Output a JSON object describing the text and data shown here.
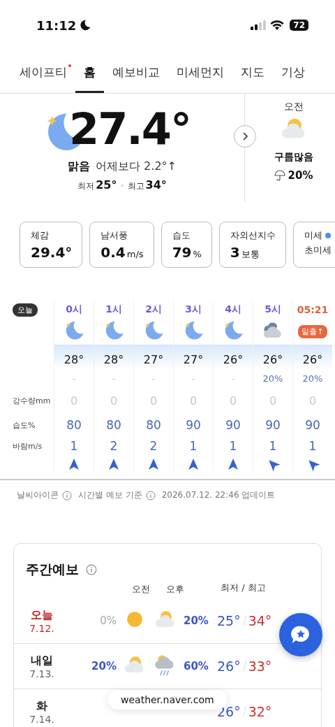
{
  "status_bar": {
    "time": "11:12",
    "battery": "72"
  },
  "tabs": [
    {
      "label": "세이프티",
      "selected": false,
      "dot": true
    },
    {
      "label": "홈",
      "selected": true,
      "dot": false
    },
    {
      "label": "예보비교",
      "selected": false,
      "dot": false
    },
    {
      "label": "미세먼지",
      "selected": false,
      "dot": false
    },
    {
      "label": "지도",
      "selected": false,
      "dot": false
    },
    {
      "label": "기상",
      "selected": false,
      "dot": false
    }
  ],
  "current": {
    "icon": {
      "kind": "moon"
    },
    "temp": "27.4°",
    "condition": "맑음",
    "compare": "어제보다 2.2°↑",
    "lo_label": "최저",
    "lo": "25°",
    "hi_label": "최고",
    "hi": "34°"
  },
  "next": {
    "label": "오전",
    "icon": {
      "kind": "cloud-sun"
    },
    "condition": "구름많음",
    "precip": "20%"
  },
  "cards": [
    {
      "label": "체감",
      "value": "29.4°"
    },
    {
      "label": "남서풍",
      "value": "0.4",
      "unit": "m/s"
    },
    {
      "label": "습도",
      "value": "79",
      "unit": "%"
    },
    {
      "label": "자외선지수",
      "value": "3",
      "unit": "보통"
    },
    {
      "kind": "dust",
      "label": "미세",
      "label2": "초미세"
    }
  ],
  "hourly": {
    "today": "오늘",
    "rain_label": "강수량mm",
    "humidity_label": "습도%",
    "wind_label": "바람m/s",
    "columns": [
      {
        "kind": "hour",
        "time": "0시",
        "icon": {
          "kind": "moon"
        },
        "temp": "28°",
        "prob": "-",
        "rain": "0",
        "humidity": "80",
        "wind": "1",
        "wind_arrow": {
          "kind": "north"
        }
      },
      {
        "kind": "hour",
        "time": "1시",
        "icon": {
          "kind": "moon"
        },
        "temp": "28°",
        "prob": "-",
        "rain": "0",
        "humidity": "80",
        "wind": "2",
        "wind_arrow": {
          "kind": "north"
        }
      },
      {
        "kind": "hour",
        "time": "2시",
        "icon": {
          "kind": "moon"
        },
        "temp": "27°",
        "prob": "-",
        "rain": "0",
        "humidity": "80",
        "wind": "2",
        "wind_arrow": {
          "kind": "north"
        }
      },
      {
        "kind": "hour",
        "time": "3시",
        "icon": {
          "kind": "moon"
        },
        "temp": "27°",
        "prob": "-",
        "rain": "0",
        "humidity": "90",
        "wind": "1",
        "wind_arrow": {
          "kind": "north"
        }
      },
      {
        "kind": "hour",
        "time": "4시",
        "icon": {
          "kind": "moon"
        },
        "temp": "26°",
        "prob": "-",
        "rain": "0",
        "humidity": "90",
        "wind": "1",
        "wind_arrow": {
          "kind": "north"
        }
      },
      {
        "kind": "hour",
        "time": "5시",
        "icon": {
          "kind": "cloud"
        },
        "temp": "26°",
        "prob": "20%",
        "rain": "0",
        "humidity": "90",
        "wind": "1",
        "wind_arrow": {
          "kind": "northwest"
        }
      },
      {
        "kind": "sunrise",
        "time": "05:21",
        "badge": "일출↑",
        "temp": "26°",
        "prob": "20%",
        "rain": "0",
        "humidity": "90",
        "wind": "1",
        "wind_arrow": {
          "kind": "northwest"
        }
      }
    ]
  },
  "footnote": {
    "icon_note": "날씨아이콘",
    "basis_note": "시간별 예보 기준",
    "updated": "2026.07.12. 22:46 업데이트"
  },
  "weekly": {
    "title": "주간예보",
    "am": "오전",
    "pm": "오후",
    "range": "최저 / 최고",
    "rows": [
      {
        "today": true,
        "day": "오늘",
        "date": "7.12.",
        "am_prob": "0%",
        "am_faded": true,
        "am_icon": {
          "kind": "sun"
        },
        "pm_icon": {
          "kind": "cloud-sun"
        },
        "pm_prob": "20%",
        "pm_faded": false,
        "lo": "25°",
        "hi": "34°"
      },
      {
        "today": false,
        "day": "내일",
        "date": "7.13.",
        "am_prob": "20%",
        "am_faded": false,
        "am_icon": {
          "kind": "cloud-sun"
        },
        "pm_icon": {
          "kind": "rain"
        },
        "pm_prob": "60%",
        "pm_faded": false,
        "lo": "26°",
        "hi": "33°"
      },
      {
        "today": false,
        "day": "화",
        "date": "7.14.",
        "lo": "26°",
        "hi": "32°"
      }
    ]
  },
  "address_bar": {
    "url": "weather.naver.com"
  }
}
